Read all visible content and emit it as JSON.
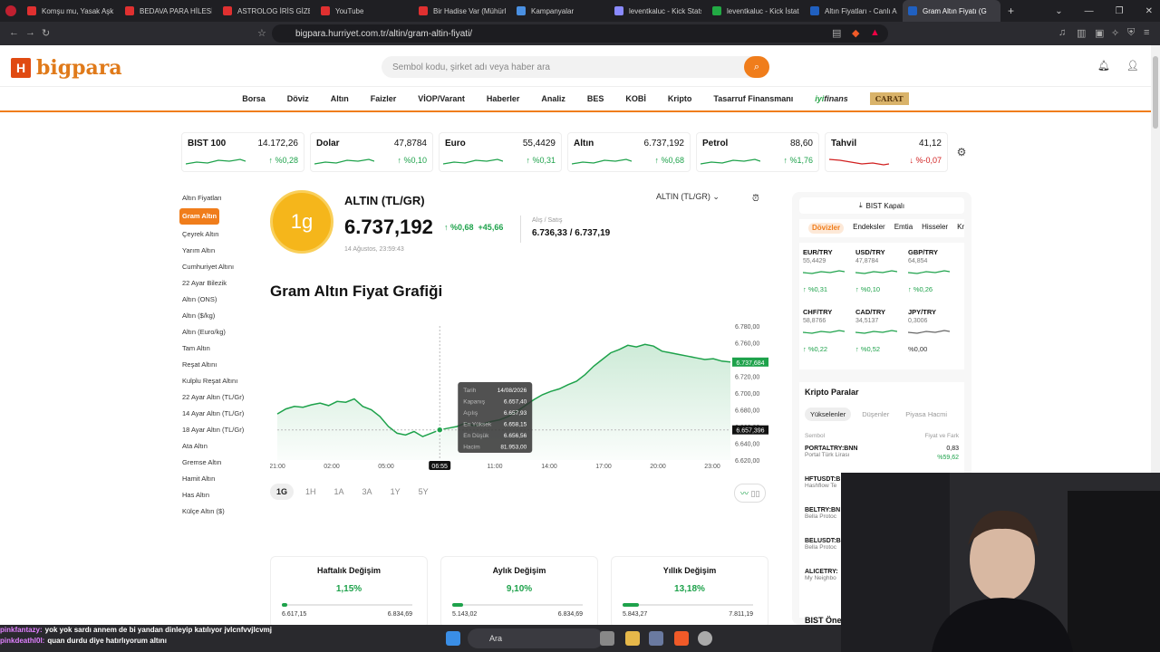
{
  "browser": {
    "tabs": [
      {
        "label": "Komşu mu, Yasak Aşk m",
        "color": "#e03030"
      },
      {
        "label": "BEDAVA PARA HİLESİ B",
        "color": "#e03030"
      },
      {
        "label": "ASTROLOG İRİS GİZEM",
        "color": "#e03030"
      },
      {
        "label": "YouTube",
        "color": "#e03030"
      },
      {
        "label": "Bir Hadise Var (Mühürle",
        "color": "#e03030"
      },
      {
        "label": "Kampanyalar",
        "color": "#4a90e2"
      },
      {
        "label": "leventkaluc - Kick Stats",
        "color": "#8a8aff"
      },
      {
        "label": "leventkaluc - Kick İstatis",
        "color": "#22aa44"
      },
      {
        "label": "Altın Fiyatları - Canlı Altı",
        "color": "#2060c0"
      },
      {
        "label": "Gram Altın Fiyatı (G",
        "color": "#2060c0",
        "active": true
      }
    ],
    "url": "bigpara.hurriyet.com.tr/altin/gram-altin-fiyati/"
  },
  "site": {
    "logo_letter": "H",
    "logo_text": "bigpara",
    "search_placeholder": "Sembol kodu, şirket adı veya haber ara",
    "menu": [
      "Borsa",
      "Döviz",
      "Altın",
      "Faizler",
      "VİOP/Varant",
      "Haberler",
      "Analiz",
      "BES",
      "KOBİ",
      "Kripto",
      "Tasarruf Finansmanı"
    ],
    "iyi_a": "iyi",
    "iyi_b": "finans",
    "carat": "CARAT"
  },
  "tickers": [
    {
      "name": "BIST 100",
      "value": "14.172,26",
      "change": "%0,28",
      "dir": "up"
    },
    {
      "name": "Dolar",
      "value": "47,8784",
      "change": "%0,10",
      "dir": "up"
    },
    {
      "name": "Euro",
      "value": "55,4429",
      "change": "%0,31",
      "dir": "up"
    },
    {
      "name": "Altın",
      "value": "6.737,192",
      "change": "%0,68",
      "dir": "up"
    },
    {
      "name": "Petrol",
      "value": "88,60",
      "change": "%1,76",
      "dir": "up"
    },
    {
      "name": "Tahvil",
      "value": "41,12",
      "change": "%-0,07",
      "dir": "down"
    }
  ],
  "sidebar": [
    {
      "label": "Altın Fiyatları"
    },
    {
      "label": "Gram Altın",
      "active": true
    },
    {
      "label": "Çeyrek Altın"
    },
    {
      "label": "Yarım Altın"
    },
    {
      "label": "Cumhuriyet Altını"
    },
    {
      "label": "22 Ayar Bilezik"
    },
    {
      "label": "Altın (ONS)"
    },
    {
      "label": "Altın ($/kg)"
    },
    {
      "label": "Altın (Euro/kg)"
    },
    {
      "label": "Tam Altın"
    },
    {
      "label": "Reşat Altını"
    },
    {
      "label": "Kulplu Reşat Altını"
    },
    {
      "label": "22 Ayar Altın (TL/Gr)"
    },
    {
      "label": "14 Ayar Altın (TL/Gr)"
    },
    {
      "label": "18 Ayar Altın (TL/Gr)"
    },
    {
      "label": "Ata Altın"
    },
    {
      "label": "Gremse Altın"
    },
    {
      "label": "Hamit Altın"
    },
    {
      "label": "Has Altın"
    },
    {
      "label": "Külçe Altın ($)"
    }
  ],
  "instrument": {
    "coin": "1g",
    "title": "ALTIN (TL/GR)",
    "price": "6.737,192",
    "change_pct": "↑ %0,68",
    "change_abs": "+45,66",
    "date": "14 Ağustos, 23:59:43",
    "bid_ask_label": "Alış / Satış",
    "bid_ask": "6.736,33 / 6.737,19",
    "selector": "ALTIN (TL/GR)"
  },
  "chart_section_title": "Gram Altın Fiyat Grafiği",
  "chart_data": {
    "type": "area",
    "x": [
      "21:00",
      "21:30",
      "22:00",
      "22:30",
      "23:00",
      "23:30",
      "00:00",
      "00:30",
      "01:00",
      "01:30",
      "02:00",
      "02:30",
      "03:00",
      "03:30",
      "04:00",
      "04:30",
      "05:00",
      "05:30",
      "06:00",
      "06:30",
      "07:00",
      "07:30",
      "08:00",
      "08:30",
      "09:00",
      "09:30",
      "10:00",
      "10:30",
      "11:00",
      "11:30",
      "12:00",
      "12:30",
      "13:00",
      "13:30",
      "14:00",
      "14:30",
      "15:00",
      "15:30",
      "16:00",
      "16:30",
      "17:00",
      "17:30",
      "18:00",
      "18:30",
      "19:00",
      "19:30",
      "20:00",
      "20:30",
      "21:00",
      "21:30",
      "22:00",
      "22:30",
      "23:00",
      "23:30"
    ],
    "values": [
      6675,
      6681,
      6684,
      6683,
      6686,
      6688,
      6685,
      6690,
      6689,
      6693,
      6684,
      6680,
      6672,
      6660,
      6652,
      6650,
      6654,
      6648,
      6652,
      6656,
      6658,
      6660,
      6664,
      6661,
      6663,
      6666,
      6668,
      6672,
      6678,
      6685,
      6692,
      6698,
      6702,
      6705,
      6710,
      6714,
      6722,
      6732,
      6740,
      6748,
      6752,
      6757,
      6755,
      6758,
      6756,
      6750,
      6748,
      6746,
      6744,
      6742,
      6740,
      6741,
      6738,
      6737
    ],
    "xticks": [
      "21:00",
      "02:00",
      "05:00",
      "08:00",
      "11:00",
      "14:00",
      "17:00",
      "20:00",
      "23:00"
    ],
    "yticks": [
      "6.620,00",
      "6.640,00",
      "6.660,00",
      "6.680,00",
      "6.700,00",
      "6.720,00",
      "6.740,00",
      "6.760,00",
      "6.780,00"
    ],
    "ylim": [
      6620,
      6780
    ],
    "last_label": "6.737,684",
    "cursor_label": "6.657,396",
    "cursor_time": "06:55",
    "tooltip": {
      "rows": [
        {
          "k": "Tarih",
          "v": "14/08/2026"
        },
        {
          "k": "Kapanış",
          "v": "6.657,40"
        },
        {
          "k": "Açılış",
          "v": "6.657,93"
        },
        {
          "k": "En Yüksek",
          "v": "6.658,15"
        },
        {
          "k": "En Düşük",
          "v": "6.656,56"
        },
        {
          "k": "Hacim",
          "v": "81.953,00"
        }
      ]
    },
    "color": "#1ea24b"
  },
  "periods": [
    "1G",
    "1H",
    "1A",
    "3A",
    "1Y",
    "5Y"
  ],
  "chart_type_btn": "〰",
  "summary_cards": [
    {
      "title": "Haftalık Değişim",
      "value": "1,15%",
      "low": "6.617,15",
      "high": "6.834,69",
      "fill": 0.02
    },
    {
      "title": "Aylık Değişim",
      "value": "9,10%",
      "low": "5.143,02",
      "high": "6.834,69",
      "fill": 0.08
    },
    {
      "title": "Yıllık Değişim",
      "value": "13,18%",
      "low": "5.843,27",
      "high": "7.811,19",
      "fill": 0.12
    }
  ],
  "right_panel": {
    "bist_status": "BIST Kapalı",
    "tabs": [
      "Dövizler",
      "Endeksler",
      "Emtia",
      "Hisseler",
      "Kripto"
    ],
    "fx": [
      {
        "name": "EUR/TRY",
        "value": "55,4429",
        "change": "↑ %0,31"
      },
      {
        "name": "USD/TRY",
        "value": "47,8784",
        "change": "↑ %0,10"
      },
      {
        "name": "GBP/TRY",
        "value": "64,854",
        "change": "↑ %0,26"
      },
      {
        "name": "CHF/TRY",
        "value": "58,8766",
        "change": "↑ %0,22"
      },
      {
        "name": "CAD/TRY",
        "value": "34,5137",
        "change": "↑ %0,52"
      },
      {
        "name": "JPY/TRY",
        "value": "0,3006",
        "change": "%0,00"
      }
    ],
    "crypto_title": "Kripto Paralar",
    "crypto_tabs": [
      "Yükselenler",
      "Düşenler",
      "Piyasa Hacmi"
    ],
    "crypto_hdr_left": "Sembol",
    "crypto_hdr_right": "Fiyat ve Fark",
    "crypto": [
      {
        "sym": "PORTALTRY:BNN",
        "full": "Portal Türk Lirası",
        "price": "0,83",
        "chg": "%59,62"
      },
      {
        "sym": "HFTUSDT:B",
        "full": "Hashflow Te",
        "price": "",
        "chg": ""
      },
      {
        "sym": "BELTRY:BN",
        "full": "Bella Protoc",
        "price": "",
        "chg": ""
      },
      {
        "sym": "BELUSDT:B",
        "full": "Bella Protoc",
        "price": "",
        "chg": ""
      },
      {
        "sym": "ALICETRY:",
        "full": "My Neighbo",
        "price": "",
        "chg": ""
      }
    ],
    "bist_one": "BIST Öne"
  },
  "chat": [
    {
      "user": "pinkfantazy:",
      "msg": "yok yok sardı annem de bi yandan dinleyip katılıyor jvlcnfvvjlcvmj"
    },
    {
      "user": "pinkdeathl0l:",
      "msg": "quan durdu diye hatırlıyorum altını"
    }
  ],
  "taskbar": {
    "search": "Ara"
  }
}
